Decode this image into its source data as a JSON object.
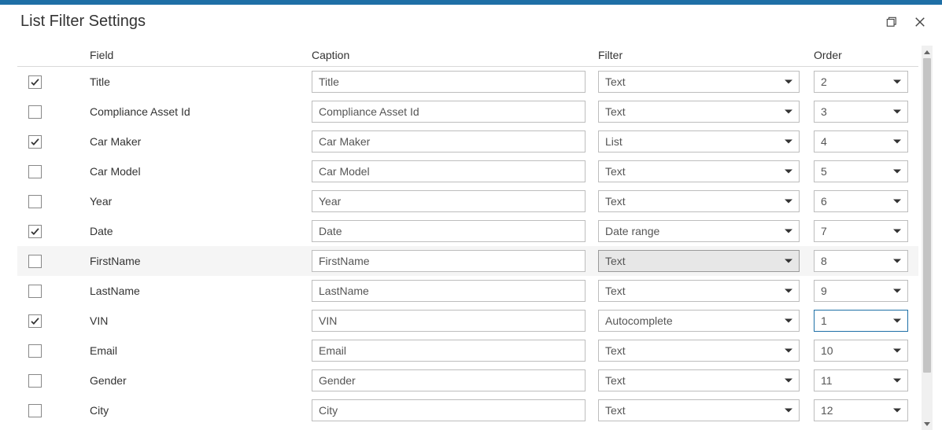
{
  "dialog": {
    "title": "List Filter Settings"
  },
  "columns": {
    "field": "Field",
    "caption": "Caption",
    "filter": "Filter",
    "order": "Order"
  },
  "rows": [
    {
      "checked": true,
      "field": "Title",
      "caption": "Title",
      "filter": "Text",
      "order": "2",
      "highlight": false,
      "filter_shaded": false,
      "order_focus": false
    },
    {
      "checked": false,
      "field": "Compliance Asset Id",
      "caption": "Compliance Asset Id",
      "filter": "Text",
      "order": "3",
      "highlight": false,
      "filter_shaded": false,
      "order_focus": false
    },
    {
      "checked": true,
      "field": "Car Maker",
      "caption": "Car Maker",
      "filter": "List",
      "order": "4",
      "highlight": false,
      "filter_shaded": false,
      "order_focus": false
    },
    {
      "checked": false,
      "field": "Car Model",
      "caption": "Car Model",
      "filter": "Text",
      "order": "5",
      "highlight": false,
      "filter_shaded": false,
      "order_focus": false
    },
    {
      "checked": false,
      "field": "Year",
      "caption": "Year",
      "filter": "Text",
      "order": "6",
      "highlight": false,
      "filter_shaded": false,
      "order_focus": false
    },
    {
      "checked": true,
      "field": "Date",
      "caption": "Date",
      "filter": "Date range",
      "order": "7",
      "highlight": false,
      "filter_shaded": false,
      "order_focus": false
    },
    {
      "checked": false,
      "field": "FirstName",
      "caption": "FirstName",
      "filter": "Text",
      "order": "8",
      "highlight": true,
      "filter_shaded": true,
      "order_focus": false
    },
    {
      "checked": false,
      "field": "LastName",
      "caption": "LastName",
      "filter": "Text",
      "order": "9",
      "highlight": false,
      "filter_shaded": false,
      "order_focus": false
    },
    {
      "checked": true,
      "field": "VIN",
      "caption": "VIN",
      "filter": "Autocomplete",
      "order": "1",
      "highlight": false,
      "filter_shaded": false,
      "order_focus": true
    },
    {
      "checked": false,
      "field": "Email",
      "caption": "Email",
      "filter": "Text",
      "order": "10",
      "highlight": false,
      "filter_shaded": false,
      "order_focus": false
    },
    {
      "checked": false,
      "field": "Gender",
      "caption": "Gender",
      "filter": "Text",
      "order": "11",
      "highlight": false,
      "filter_shaded": false,
      "order_focus": false
    },
    {
      "checked": false,
      "field": "City",
      "caption": "City",
      "filter": "Text",
      "order": "12",
      "highlight": false,
      "filter_shaded": false,
      "order_focus": false
    }
  ]
}
